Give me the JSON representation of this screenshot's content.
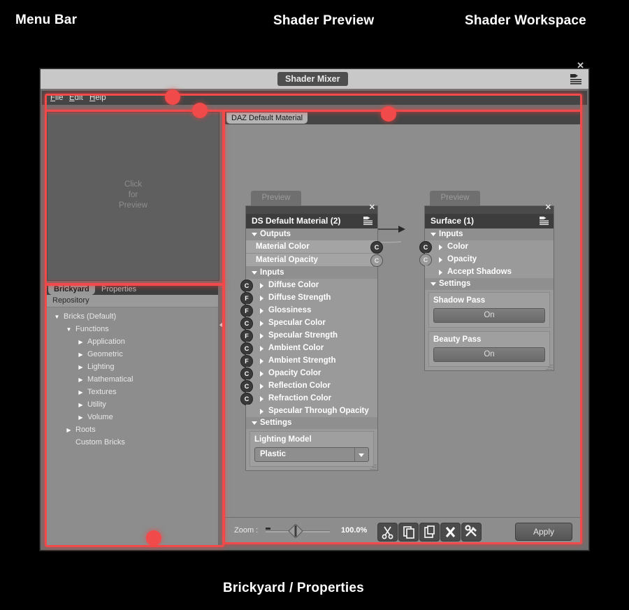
{
  "annotations": [
    {
      "id": "menu-bar",
      "label": "Menu Bar"
    },
    {
      "id": "shader-preview",
      "label": "Shader Preview"
    },
    {
      "id": "shader-workspace",
      "label": "Shader Workspace"
    },
    {
      "id": "brickyard-properties",
      "label": "Brickyard / Properties"
    }
  ],
  "window": {
    "title_tab": "Shader Mixer",
    "close_label": "✕",
    "menu_icon": "list-menu-icon"
  },
  "menubar": {
    "items": [
      {
        "accel": "F",
        "rest": "ile"
      },
      {
        "accel": "E",
        "rest": "dit"
      },
      {
        "accel": "H",
        "rest": "elp"
      }
    ]
  },
  "preview": {
    "line1": "Click",
    "line2": "for",
    "line3": "Preview"
  },
  "brickyard": {
    "tabs": [
      {
        "label": "Brickyard",
        "active": true
      },
      {
        "label": "Properties",
        "active": false
      }
    ],
    "repository_label": "Repository",
    "tree": [
      {
        "label": "Bricks (Default)",
        "indent": 0,
        "twisty": "down"
      },
      {
        "label": "Functions",
        "indent": 1,
        "twisty": "down"
      },
      {
        "label": "Application",
        "indent": 2,
        "twisty": "right"
      },
      {
        "label": "Geometric",
        "indent": 2,
        "twisty": "right"
      },
      {
        "label": "Lighting",
        "indent": 2,
        "twisty": "right"
      },
      {
        "label": "Mathematical",
        "indent": 2,
        "twisty": "right"
      },
      {
        "label": "Textures",
        "indent": 2,
        "twisty": "right"
      },
      {
        "label": "Utility",
        "indent": 2,
        "twisty": "right"
      },
      {
        "label": "Volume",
        "indent": 2,
        "twisty": "right"
      },
      {
        "label": "Roots",
        "indent": 1,
        "twisty": "right"
      },
      {
        "label": "Custom Bricks",
        "indent": 1,
        "twisty": "none"
      }
    ]
  },
  "workspace": {
    "tab_label": "DAZ Default Material",
    "nodes": {
      "material": {
        "preview_tab": "Preview",
        "title": "DS Default Material (2)",
        "close_label": "✕",
        "outputs_label": "Outputs",
        "outputs": [
          {
            "label": "Material Color",
            "port": "C",
            "filled": true
          },
          {
            "label": "Material Opacity",
            "port": "C",
            "filled": false
          }
        ],
        "inputs_label": "Inputs",
        "inputs": [
          {
            "label": "Diffuse Color",
            "port": "C",
            "filled": true
          },
          {
            "label": "Diffuse Strength",
            "port": "F",
            "filled": true
          },
          {
            "label": "Glossiness",
            "port": "F",
            "filled": true
          },
          {
            "label": "Specular Color",
            "port": "C",
            "filled": true
          },
          {
            "label": "Specular Strength",
            "port": "F",
            "filled": true
          },
          {
            "label": "Ambient Color",
            "port": "C",
            "filled": true
          },
          {
            "label": "Ambient Strength",
            "port": "F",
            "filled": true
          },
          {
            "label": "Opacity Color",
            "port": "C",
            "filled": true
          },
          {
            "label": "Reflection Color",
            "port": "C",
            "filled": true
          },
          {
            "label": "Refraction Color",
            "port": "C",
            "filled": true
          },
          {
            "label": "Specular Through Opacity",
            "port": "",
            "filled": false
          }
        ],
        "settings_label": "Settings",
        "lighting_model_label": "Lighting Model",
        "lighting_model_value": "Plastic"
      },
      "surface": {
        "preview_tab": "Preview",
        "title": "Surface (1)",
        "close_label": "✕",
        "inputs_label": "Inputs",
        "inputs": [
          {
            "label": "Color",
            "port": "C",
            "filled": true
          },
          {
            "label": "Opacity",
            "port": "C",
            "filled": false
          },
          {
            "label": "Accept Shadows",
            "port": "",
            "filled": false
          }
        ],
        "settings_label": "Settings",
        "shadow_pass_label": "Shadow Pass",
        "shadow_pass_value": "On",
        "beauty_pass_label": "Beauty Pass",
        "beauty_pass_value": "On"
      }
    }
  },
  "bottombar": {
    "zoom_label": "Zoom :",
    "zoom_value": "100.0%",
    "tools": [
      {
        "name": "cut-icon"
      },
      {
        "name": "copy-icon"
      },
      {
        "name": "paste-icon"
      },
      {
        "name": "delete-icon"
      },
      {
        "name": "tools-icon"
      }
    ],
    "apply_label": "Apply"
  },
  "colors": {
    "highlight": "#f04a4a",
    "window_bg": "#6e6e6e",
    "titlebar": "#c8c8c8",
    "node_header": "#3d3d3d",
    "panel": "#8d8d8d"
  }
}
